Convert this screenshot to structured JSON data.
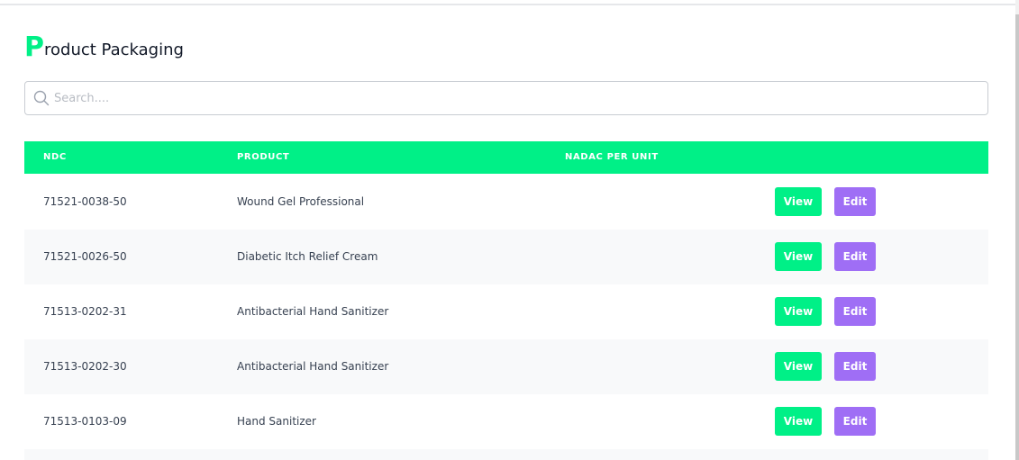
{
  "page": {
    "title_initial": "P",
    "title_rest": "roduct Packaging"
  },
  "colors": {
    "accent": "#00f087",
    "edit": "#9f6ef5",
    "row_alt": "#f8f9fa"
  },
  "search": {
    "placeholder": "Search....",
    "value": "",
    "icon": "search-icon"
  },
  "table": {
    "columns": [
      "NDC",
      "PRODUCT",
      "NADAC PER UNIT"
    ],
    "rows": [
      {
        "ndc": "71521-0038-50",
        "product": "Wound Gel Professional",
        "nadac": "",
        "view_label": "View",
        "edit_label": "Edit"
      },
      {
        "ndc": "71521-0026-50",
        "product": "Diabetic Itch Relief Cream",
        "nadac": "",
        "view_label": "View",
        "edit_label": "Edit"
      },
      {
        "ndc": "71513-0202-31",
        "product": "Antibacterial Hand Sanitizer",
        "nadac": "",
        "view_label": "View",
        "edit_label": "Edit"
      },
      {
        "ndc": "71513-0202-30",
        "product": "Antibacterial Hand Sanitizer",
        "nadac": "",
        "view_label": "View",
        "edit_label": "Edit"
      },
      {
        "ndc": "71513-0103-09",
        "product": "Hand Sanitizer",
        "nadac": "",
        "view_label": "View",
        "edit_label": "Edit"
      }
    ]
  }
}
